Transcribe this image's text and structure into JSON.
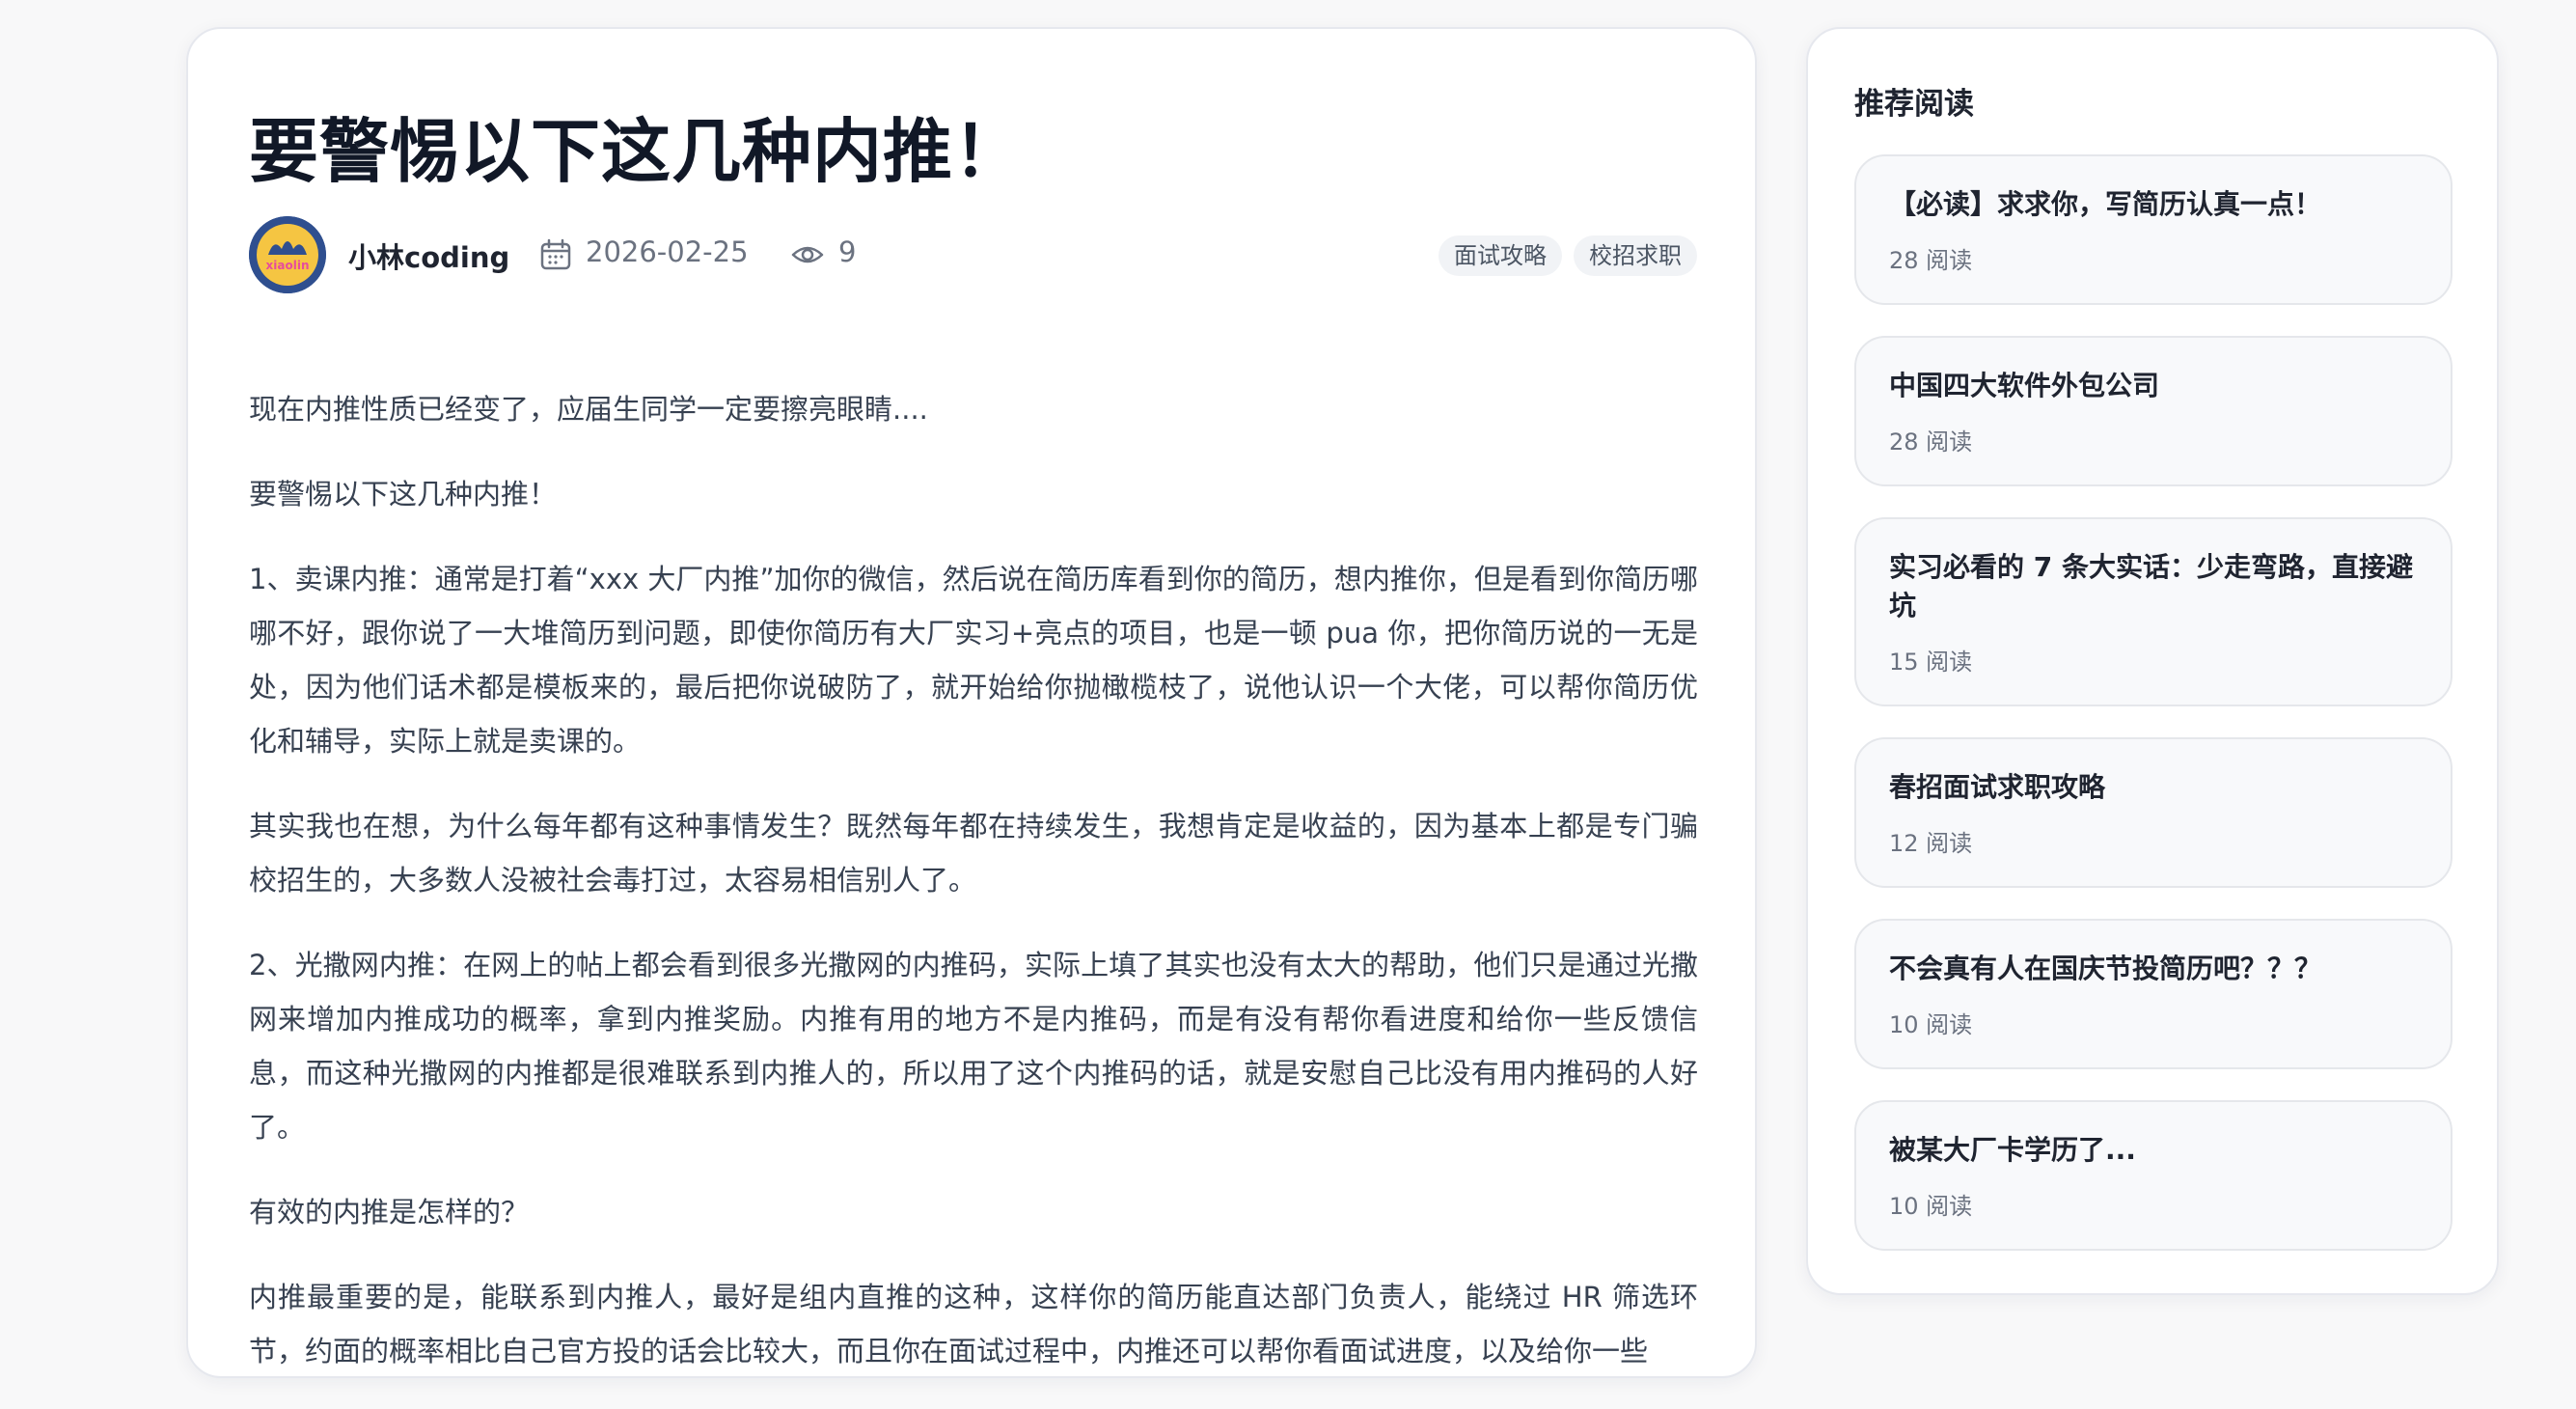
{
  "article": {
    "title": "要警惕以下这几种内推！",
    "author": "小林coding",
    "date": "2026-02-25",
    "views": "9",
    "tags": [
      "面试攻略",
      "校招求职"
    ],
    "paragraphs": [
      "现在内推性质已经变了，应届生同学一定要擦亮眼睛....",
      "要警惕以下这几种内推！",
      "1、卖课内推：通常是打着“xxx 大厂内推”加你的微信，然后说在简历库看到你的简历，想内推你，但是看到你简历哪哪不好，跟你说了一大堆简历到问题，即使你简历有大厂实习+亮点的项目，也是一顿 pua 你，把你简历说的一无是处，因为他们话术都是模板来的，最后把你说破防了，就开始给你抛橄榄枝了，说他认识一个大佬，可以帮你简历优化和辅导，实际上就是卖课的。",
      "其实我也在想，为什么每年都有这种事情发生？既然每年都在持续发生，我想肯定是收益的，因为基本上都是专门骗校招生的，大多数人没被社会毒打过，太容易相信别人了。",
      "2、光撒网内推：在网上的帖上都会看到很多光撒网的内推码，实际上填了其实也没有太大的帮助，他们只是通过光撒网来增加内推成功的概率，拿到内推奖励。内推有用的地方不是内推码，而是有没有帮你看进度和给你一些反馈信息，而这种光撒网的内推都是很难联系到内推人的，所以用了这个内推码的话，就是安慰自己比没有用内推码的人好了。",
      "有效的内推是怎样的？",
      "内推最重要的是，能联系到内推人，最好是组内直推的这种，这样你的简历能直达部门负责人，能绕过 HR 筛选环节，约面的概率相比自己官方投的话会比较大，而且你在面试过程中，内推还可以帮你看面试进度，以及给你一些"
    ]
  },
  "sidebar": {
    "title": "推荐阅读",
    "items": [
      {
        "title": "【必读】求求你，写简历认真一点！",
        "reads": "28 阅读"
      },
      {
        "title": "中国四大软件外包公司",
        "reads": "28 阅读"
      },
      {
        "title": "实习必看的 7 条大实话：少走弯路，直接避坑",
        "reads": "15 阅读"
      },
      {
        "title": "春招面试求职攻略",
        "reads": "12 阅读"
      },
      {
        "title": "不会真有人在国庆节投简历吧？？？",
        "reads": "10 阅读"
      },
      {
        "title": "被某大厂卡学历了...",
        "reads": "10 阅读"
      }
    ]
  },
  "colors": {
    "avatar_bg": "#2f4f8f",
    "avatar_accent": "#f5c542",
    "avatar_text": "#e74c9c"
  },
  "icons": {
    "date": "calendar-icon",
    "views": "eye-icon"
  }
}
